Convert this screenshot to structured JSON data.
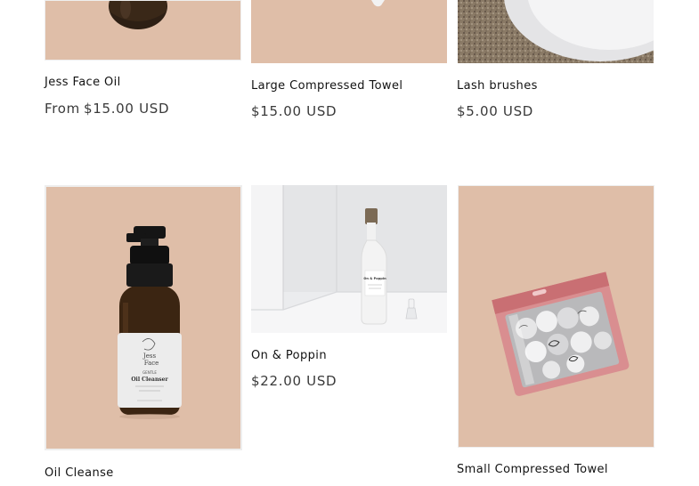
{
  "products": [
    {
      "title": "Jess Face Oil",
      "price_prefix": "From",
      "price": "$15.00 USD",
      "image_icon": "face-oil-bottle-image",
      "image_bg": "#dfbea8"
    },
    {
      "title": "Large Compressed Towel",
      "price": "$15.00 USD",
      "image_icon": "compressed-towel-image",
      "image_bg": "#dfbea8"
    },
    {
      "title": "Lash brushes",
      "price": "$5.00 USD",
      "image_icon": "lash-brushes-image",
      "image_bg": "#8c7d6a"
    },
    {
      "title": "Oil Cleanse",
      "image_icon": "oil-cleanser-bottle-image",
      "image_bg": "#dfbea8",
      "label_lines": [
        "Jess",
        "Face",
        "GENTLE",
        "Oil Cleanser"
      ]
    },
    {
      "title": "On & Poppin",
      "price": "$22.00 USD",
      "image_icon": "spray-bottle-image",
      "image_bg": "#e8e9ea",
      "label_lines": [
        "On & Poppin"
      ]
    },
    {
      "title": "Small Compressed Towel",
      "image_icon": "towel-packet-image",
      "image_bg": "#dfbea8"
    }
  ]
}
